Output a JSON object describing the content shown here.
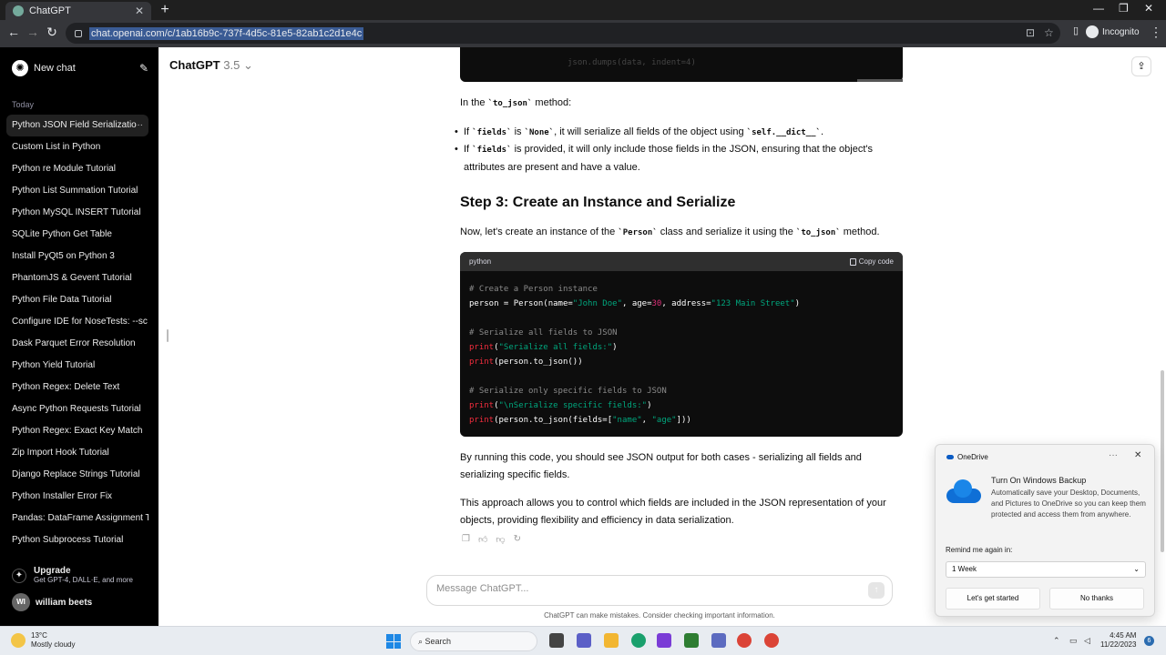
{
  "browser": {
    "tab_title": "ChatGPT",
    "tab_close": "✕",
    "new_tab": "+",
    "url": "chat.openai.com/c/1ab16b9c-737f-4d5c-81e5-82ab1c2d1e4c",
    "profile_label": "Incognito",
    "window_controls": [
      "—",
      "❐",
      "✕"
    ]
  },
  "sidebar": {
    "new_chat": "New chat",
    "section_label": "Today",
    "chats": [
      "Python JSON Field Serializatio",
      "Custom List in Python",
      "Python re Module Tutorial",
      "Python List Summation Tutorial",
      "Python MySQL INSERT Tutorial",
      "SQLite Python Get Table",
      "Install PyQt5 on Python 3",
      "PhantomJS & Gevent Tutorial",
      "Python File Data Tutorial",
      "Configure IDE for NoseTests: --sc",
      "Dask Parquet Error Resolution",
      "Python Yield Tutorial",
      "Python Regex: Delete Text",
      "Async Python Requests Tutorial",
      "Python Regex: Exact Key Match",
      "Zip Import Hook Tutorial",
      "Django Replace Strings Tutorial",
      "Python Installer Error Fix",
      "Pandas: DataFrame Assignment T",
      "Python Subprocess Tutorial"
    ],
    "chat_menu": "···",
    "upgrade_title": "Upgrade",
    "upgrade_sub": "Get GPT-4, DALL·E, and more",
    "user_initials": "WI",
    "user_name": "william beets"
  },
  "header": {
    "model_name": "ChatGPT",
    "model_version": "3.5"
  },
  "content": {
    "code_top_faint": "json.dumps(data, indent=4)",
    "in_the": "In the ",
    "to_json": "`to_json`",
    "method_suffix": " method:",
    "b1_if": "If ",
    "fields": "`fields`",
    "b1_is": " is ",
    "none": "`None`",
    "b1_rest": ", it will serialize all fields of the object using ",
    "self_dict": "`self.__dict__`",
    "period": ".",
    "b2_rest": " is provided, it will only include those fields in the JSON, ensuring that the object's attributes are present and have a value.",
    "step3": "Step 3: Create an Instance and Serialize",
    "now_a": "Now, let's create an instance of the ",
    "person": "`Person`",
    "now_b": " class and serialize it using the ",
    "now_c": " method.",
    "code_lang": "python",
    "copy_code": "Copy code",
    "code": {
      "l1": "# Create a Person instance",
      "l2a": "person = Person(name=",
      "l2b": "\"John Doe\"",
      "l2c": ", age=",
      "l2d": "30",
      "l2e": ", address=",
      "l2f": "\"123 Main Street\"",
      "l2g": ")",
      "l3": "# Serialize all fields to JSON",
      "l4a": "print",
      "l4b": "(",
      "l4c": "\"Serialize all fields:\"",
      "l4d": ")",
      "l5a": "print",
      "l5b": "(person.to_json())",
      "l6": "# Serialize only specific fields to JSON",
      "l7a": "print",
      "l7b": "(",
      "l7c": "\"\\nSerialize specific fields:\"",
      "l7d": ")",
      "l8a": "print",
      "l8b": "(person.to_json(fields=[",
      "l8c": "\"name\"",
      "l8d": ", ",
      "l8e": "\"age\"",
      "l8f": "]))"
    },
    "p_running": "By running this code, you should see JSON output for both cases - serializing all fields and serializing specific fields.",
    "p_approach": "This approach allows you to control which fields are included in the JSON representation of your objects, providing flexibility and efficiency in data serialization."
  },
  "composer": {
    "placeholder": "Message ChatGPT...",
    "send": "↑",
    "disclaimer": "ChatGPT can make mistakes. Consider checking important information."
  },
  "toast": {
    "app_name": "OneDrive",
    "more": "···",
    "close": "✕",
    "title": "Turn On Windows Backup",
    "body": "Automatically save your Desktop, Documents, and Pictures to OneDrive so you can keep them protected and access them from anywhere.",
    "remind_label": "Remind me again in:",
    "remind_value": "1 Week",
    "primary": "Let's get started",
    "secondary": "No thanks"
  },
  "taskbar": {
    "temp": "13°C",
    "weather": "Mostly cloudy",
    "search": "Search",
    "time": "4:45 AM",
    "date": "11/22/2023",
    "notifications": "6"
  },
  "colors": {
    "sidebar_bg": "#000000",
    "code_bg": "#0d0d0d",
    "code_string": "#00a67d",
    "code_number": "#df3079",
    "code_function": "#f22c3d"
  }
}
